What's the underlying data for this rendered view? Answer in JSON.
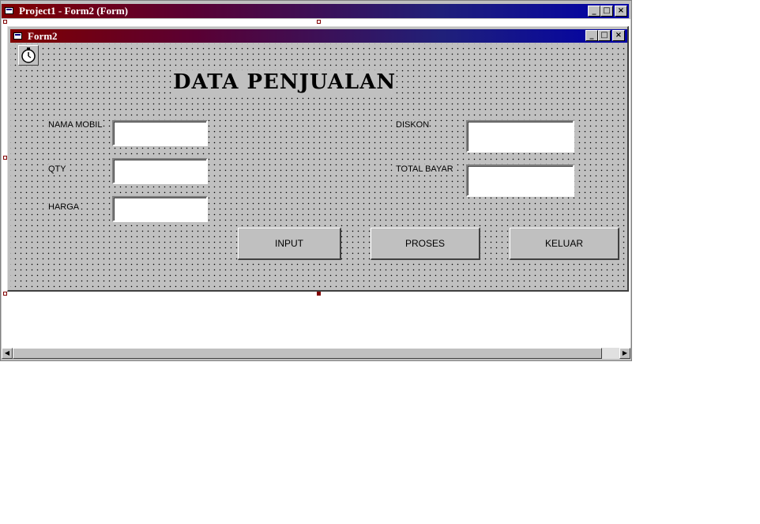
{
  "outer_window": {
    "title": "Project1 - Form2 (Form)",
    "controls": {
      "minimize": "_",
      "maximize": "□",
      "close": "×"
    }
  },
  "form": {
    "title": "Form2",
    "heading": "DATA PENJUALAN",
    "controls": {
      "minimize": "_",
      "maximize": "□",
      "close": "×"
    },
    "labels": {
      "nama_mobil": "NAMA MOBIL",
      "qty": "QTY",
      "harga": "HARGA",
      "diskon": "DISKON",
      "total_bayar": "TOTAL BAYAR"
    },
    "fields": {
      "nama_mobil": "",
      "qty": "",
      "harga": "",
      "diskon": "",
      "total_bayar": ""
    },
    "buttons": {
      "input": "INPUT",
      "proses": "PROSES",
      "keluar": "KELUAR"
    },
    "timer_icon": "stopwatch-icon"
  },
  "colors": {
    "title_gradient_start": "#800000",
    "title_gradient_end": "#0000a8",
    "form_background": "#c0c0c0"
  }
}
